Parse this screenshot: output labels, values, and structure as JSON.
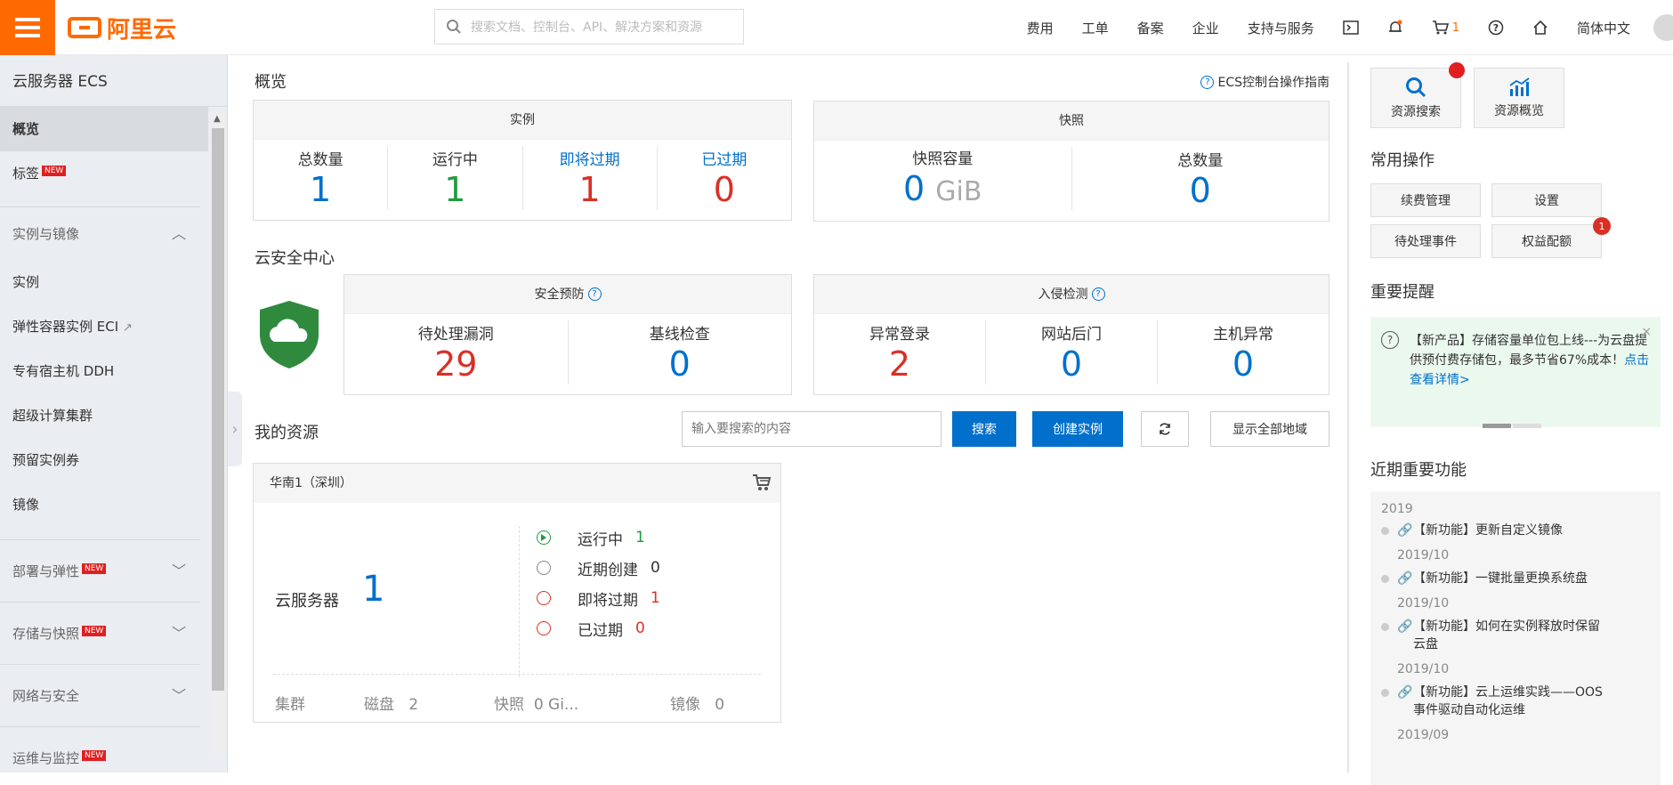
{
  "topbar": {
    "logo_text": "阿里云",
    "search_placeholder": "搜索文档、控制台、API、解决方案和资源",
    "nav": [
      "费用",
      "工单",
      "备案",
      "企业",
      "支持与服务"
    ],
    "cart_count": "1",
    "language": "简体中文"
  },
  "sidebar": {
    "title": "云服务器 ECS",
    "items": [
      {
        "label": "概览"
      },
      {
        "label": "标签",
        "badge": "NEW"
      }
    ],
    "group_instances": "实例与镜像",
    "instance_items": [
      "实例",
      "弹性容器实例 ECI",
      "专有宿主机 DDH",
      "超级计算集群",
      "预留实例券",
      "镜像"
    ],
    "groups": [
      {
        "label": "部署与弹性",
        "badge": "NEW"
      },
      {
        "label": "存储与快照",
        "badge": "NEW"
      },
      {
        "label": "网络与安全"
      },
      {
        "label": "运维与监控",
        "badge": "NEW"
      }
    ]
  },
  "overview": {
    "title": "概览",
    "guide": "ECS控制台操作指南",
    "instances": {
      "header": "实例",
      "stats": [
        {
          "label": "总数量",
          "value": "1"
        },
        {
          "label": "运行中",
          "value": "1"
        },
        {
          "label": "即将过期",
          "value": "1"
        },
        {
          "label": "已过期",
          "value": "0"
        }
      ]
    },
    "snapshots": {
      "header": "快照",
      "capacity_label": "快照容量",
      "capacity_value": "0",
      "capacity_unit": "GiB",
      "total_label": "总数量",
      "total_value": "0"
    }
  },
  "security": {
    "title": "云安全中心",
    "prevention": {
      "header": "安全预防",
      "stats": [
        {
          "label": "待处理漏洞",
          "value": "29"
        },
        {
          "label": "基线检查",
          "value": "0"
        }
      ]
    },
    "intrusion": {
      "header": "入侵检测",
      "stats": [
        {
          "label": "异常登录",
          "value": "2"
        },
        {
          "label": "网站后门",
          "value": "0"
        },
        {
          "label": "主机异常",
          "value": "0"
        }
      ]
    }
  },
  "resources": {
    "title": "我的资源",
    "search_placeholder": "输入要搜索的内容",
    "search_btn": "搜索",
    "create_btn": "创建实例",
    "show_all_btn": "显示全部地域",
    "region": {
      "name": "华南1（深圳）",
      "server_label": "云服务器",
      "server_count": "1",
      "statuses": [
        {
          "label": "运行中",
          "value": "1"
        },
        {
          "label": "近期创建",
          "value": "0"
        },
        {
          "label": "即将过期",
          "value": "1"
        },
        {
          "label": "已过期",
          "value": "0"
        }
      ],
      "footer": [
        {
          "label": "集群",
          "value": ""
        },
        {
          "label": "磁盘",
          "value": "2"
        },
        {
          "label": "快照",
          "value": "0 Gi..."
        },
        {
          "label": "镜像",
          "value": "0"
        }
      ]
    }
  },
  "right_panel": {
    "quick": [
      {
        "label": "资源搜索",
        "icon": "search-icon"
      },
      {
        "label": "资源概览",
        "icon": "bar-chart-icon"
      }
    ],
    "common_ops_title": "常用操作",
    "ops": [
      "续费管理",
      "设置",
      "待处理事件",
      "权益配额"
    ],
    "ops_badge": "1",
    "alerts_title": "重要提醒",
    "notice_text": "【新产品】存储容量单位包上线---为云盘提供预付费存储包，最多节省67%成本！",
    "notice_link": "点击查看详情>",
    "features_title": "近期重要功能",
    "year": "2019",
    "features": [
      {
        "text": "【新功能】更新自定义镜像",
        "date": "2019/10"
      },
      {
        "text": "【新功能】一键批量更换系统盘",
        "date": "2019/10"
      },
      {
        "text": "【新功能】如何在实例释放时保留云盘",
        "date": "2019/10"
      },
      {
        "text": "【新功能】云上运维实践——OOS事件驱动自动化运维",
        "date": "2019/09"
      }
    ]
  }
}
